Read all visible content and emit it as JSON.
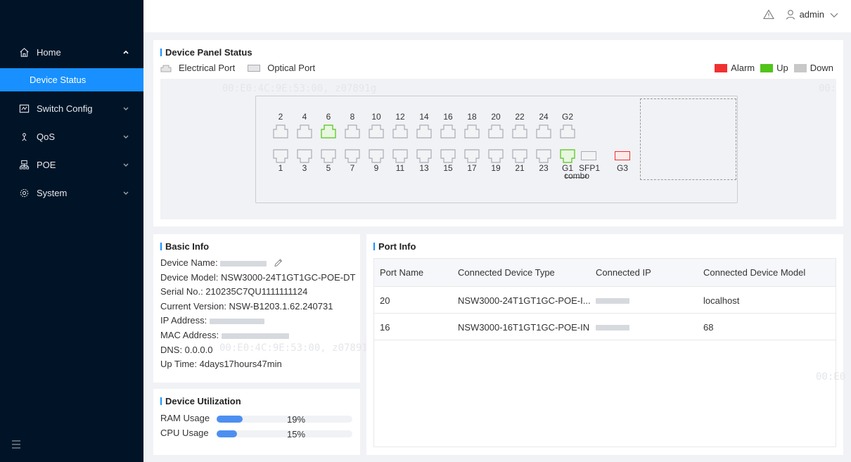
{
  "sidebar": {
    "items": [
      {
        "label": "Home",
        "icon": "home-icon",
        "expanded": true
      },
      {
        "label": "Switch Config",
        "icon": "switch-config-icon"
      },
      {
        "label": "QoS",
        "icon": "qos-icon"
      },
      {
        "label": "POE",
        "icon": "poe-icon"
      },
      {
        "label": "System",
        "icon": "gear-icon"
      }
    ],
    "active_subitem": "Device Status",
    "accent": "#1890ff",
    "background": "#011427"
  },
  "topbar": {
    "user": "admin",
    "alarm_icon": "warning-icon",
    "user_icon": "user-icon"
  },
  "device_panel": {
    "title": "Device Panel Status",
    "legend": {
      "electrical": "Electrical Port",
      "optical": "Optical Port"
    },
    "status_legend": {
      "alarm": "Alarm",
      "up": "Up",
      "down": "Down"
    },
    "status_colors": {
      "alarm": "#f23030",
      "up": "#52c41a",
      "down": "#c8c8c8"
    },
    "watermark": "00:E0:4C:9E:53:00, z07891g",
    "watermark_edge": "00:E0",
    "top_ports": [
      "2",
      "4",
      "6",
      "8",
      "10",
      "12",
      "14",
      "16",
      "18",
      "20",
      "22",
      "24"
    ],
    "bottom_ports": [
      "1",
      "3",
      "5",
      "7",
      "9",
      "11",
      "13",
      "15",
      "17",
      "19",
      "21",
      "23"
    ],
    "up_ports": [
      "6"
    ],
    "combo": {
      "g2": "G2",
      "g1": "G1",
      "sfp1": "SFP1",
      "g3": "G3",
      "label": "combo"
    }
  },
  "basic_info": {
    "title": "Basic Info",
    "device_name_label": "Device Name:",
    "device_model": "Device Model: NSW3000-24T1GT1GC-POE-DT",
    "serial": "Serial No.: 210235C7QU1111111124",
    "version": "Current Version: NSW-B1203.1.62.240731",
    "ip_label": "IP Address:",
    "mac_label": "MAC Address:",
    "dns": "DNS: 0.0.0.0",
    "uptime": "Up Time: 4days17hours47min",
    "watermark": "00:E0:4C:9E:53:00, z07891g"
  },
  "utilization": {
    "title": "Device Utilization",
    "ram_label": "RAM Usage",
    "ram_value": "19%",
    "ram_fraction": 0.19,
    "cpu_label": "CPU Usage",
    "cpu_value": "15%",
    "cpu_fraction": 0.15
  },
  "port_info": {
    "title": "Port Info",
    "columns": [
      "Port Name",
      "Connected Device Type",
      "Connected IP",
      "Connected Device Model"
    ],
    "rows": [
      {
        "port": "20",
        "type": "NSW3000-24T1GT1GC-POE-I...",
        "model": "localhost"
      },
      {
        "port": "16",
        "type": "NSW3000-16T1GT1GC-POE-IN",
        "model": "68"
      }
    ],
    "watermark_edge": "00:E0"
  }
}
